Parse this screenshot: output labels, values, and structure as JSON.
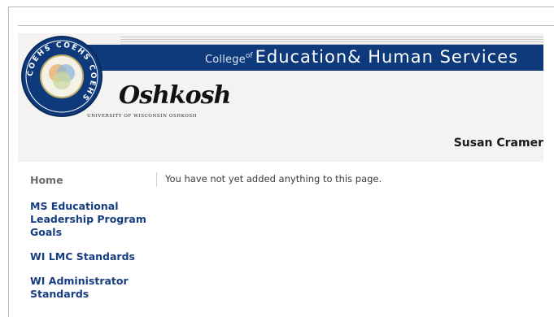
{
  "header": {
    "college_label": "College",
    "college_of": "of",
    "college_name": "Education& Human Services",
    "seal_text": "COEHS COEHS COEHS",
    "oshkosh_wordmark": "Oshkosh",
    "university_line": "UNIVERSITY OF WISCONSIN OSHKOSH",
    "brand_color": "#0e3a7b"
  },
  "user": {
    "name": "Susan Cramer"
  },
  "sidebar": {
    "items": [
      {
        "label": "Home"
      },
      {
        "label": "MS Educational Leadership Program Goals"
      },
      {
        "label": "WI LMC Standards"
      },
      {
        "label": "WI Administrator Standards"
      }
    ]
  },
  "main": {
    "empty_message": "You have not yet added anything to this page."
  }
}
